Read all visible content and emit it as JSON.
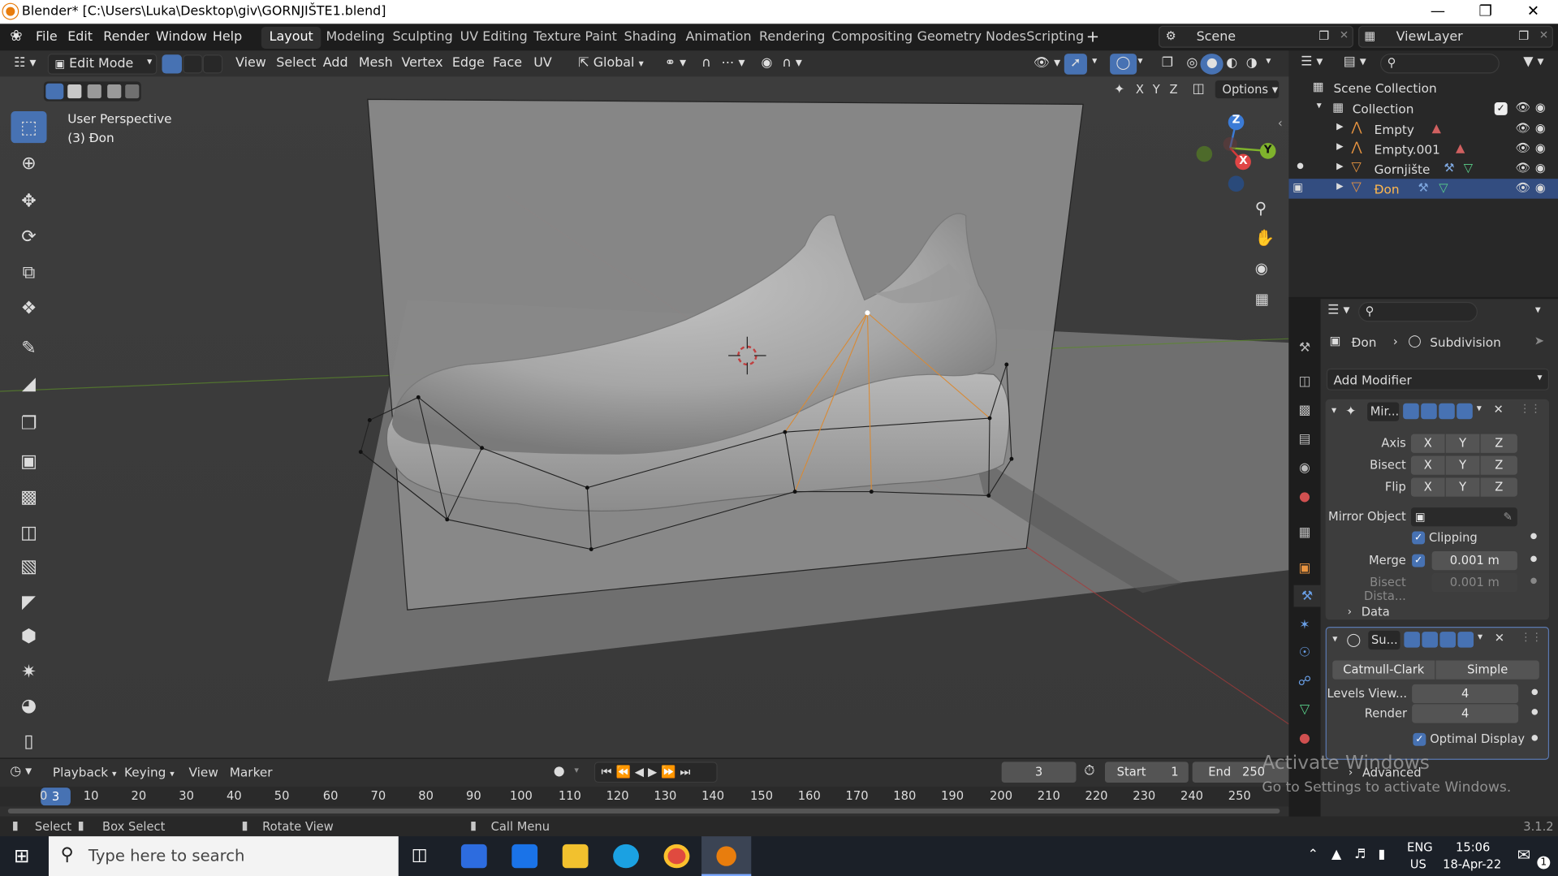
{
  "window": {
    "title": "Blender* [C:\\Users\\Luka\\Desktop\\giv\\GORNJIŠTE1.blend]"
  },
  "menu": {
    "items": [
      "File",
      "Edit",
      "Render",
      "Window",
      "Help"
    ]
  },
  "workspaces": [
    "Layout",
    "Modeling",
    "Sculpting",
    "UV Editing",
    "Texture Paint",
    "Shading",
    "Animation",
    "Rendering",
    "Compositing",
    "Geometry Nodes",
    "Scripting"
  ],
  "scene": {
    "label": "Scene",
    "view_layer": "ViewLayer"
  },
  "header": {
    "mode": "Edit Mode",
    "menus": [
      "View",
      "Select",
      "Add",
      "Mesh",
      "Vertex",
      "Edge",
      "Face",
      "UV"
    ],
    "orientation": "Global",
    "options": "Options",
    "axes": [
      "X",
      "Y",
      "Z"
    ]
  },
  "viewport": {
    "perspective": "User Perspective",
    "object_info": "(3) Đon",
    "gizmo_axes": [
      "Z",
      "Y",
      "X"
    ]
  },
  "outliner": {
    "root": "Scene Collection",
    "collection": "Collection",
    "items": [
      {
        "name": "Empty",
        "selected": false
      },
      {
        "name": "Empty.001",
        "selected": false
      },
      {
        "name": "Gornjište",
        "selected": false
      },
      {
        "name": "Đon",
        "selected": true
      }
    ]
  },
  "properties": {
    "breadcrumb_object": "Đon",
    "breadcrumb_modifier": "Subdivision",
    "add_modifier": "Add Modifier",
    "mirror": {
      "name": "Mir...",
      "axis_label": "Axis",
      "bisect_label": "Bisect",
      "flip_label": "Flip",
      "xyz": [
        "X",
        "Y",
        "Z"
      ],
      "mirror_object_label": "Mirror Object",
      "clipping_label": "Clipping",
      "merge_label": "Merge",
      "merge_value": "0.001 m",
      "bisect_dist_label": "Bisect Dista...",
      "bisect_dist_value": "0.001 m",
      "data_label": "Data"
    },
    "subsurf": {
      "name": "Su...",
      "method_a": "Catmull-Clark",
      "method_b": "Simple",
      "levels_label": "Levels View...",
      "levels_value": "4",
      "render_label": "Render",
      "render_value": "4",
      "optimal_label": "Optimal Display",
      "advanced_label": "Advanced"
    }
  },
  "timeline": {
    "menus": [
      "Playback",
      "Keying",
      "View",
      "Marker"
    ],
    "current_frame": "3",
    "start_label": "Start",
    "start_value": "1",
    "end_label": "End",
    "end_value": "250",
    "ruler": [
      "0",
      "10",
      "20",
      "30",
      "40",
      "50",
      "60",
      "70",
      "80",
      "90",
      "100",
      "110",
      "120",
      "130",
      "140",
      "150",
      "160",
      "170",
      "180",
      "190",
      "200",
      "210",
      "220",
      "230",
      "240",
      "250"
    ],
    "frame_marker": "3"
  },
  "statusbar": {
    "select": "Select",
    "box_select": "Box Select",
    "rotate": "Rotate View",
    "call_menu": "Call Menu",
    "version": "3.1.2"
  },
  "watermark": {
    "line1": "Activate Windows",
    "line2": "Go to Settings to activate Windows."
  },
  "taskbar": {
    "search_placeholder": "Type here to search",
    "lang1": "ENG",
    "lang2": "US",
    "time": "15:06",
    "date": "18-Apr-22",
    "notif": "1"
  }
}
